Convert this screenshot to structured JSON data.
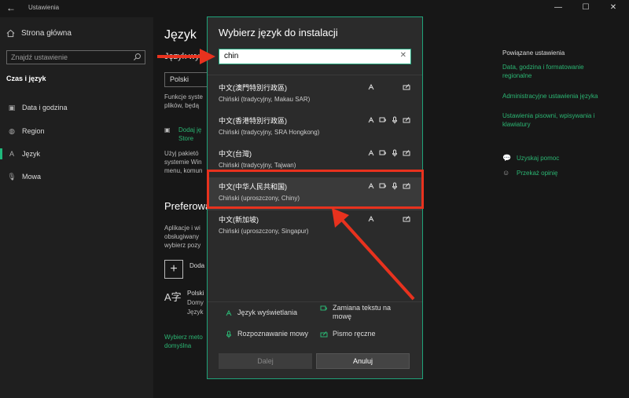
{
  "window": {
    "title": "Ustawienia",
    "back_glyph": "←",
    "controls": {
      "minimize": "—",
      "maximize": "☐",
      "close": "✕"
    }
  },
  "sidebar": {
    "home": {
      "icon": "home-icon",
      "label": "Strona główna"
    },
    "search": {
      "placeholder": "Znajdź ustawienie",
      "icon": "search-icon"
    },
    "section": "Czas i język",
    "items": [
      {
        "icon": "calendar-clock-icon",
        "label": "Data i godzina",
        "active": false
      },
      {
        "icon": "globe-icon",
        "label": "Region",
        "active": false
      },
      {
        "icon": "language-icon",
        "label": "Język",
        "active": true
      },
      {
        "icon": "microphone-icon",
        "label": "Mowa",
        "active": false
      }
    ]
  },
  "main": {
    "title": "Język",
    "subtitle": "Język wyśw",
    "select_value": "Polski",
    "text1": [
      "Funkcje syste",
      "plików, będą"
    ],
    "store_link": [
      "Dodaj ję",
      "Store"
    ],
    "text2": [
      "Użyj pakietó",
      "systemie Win",
      "menu, komun"
    ],
    "preferred_heading": "Preferowa",
    "text3": [
      "Aplikacje i wi",
      "obsługiwany",
      "wybierz pozy"
    ],
    "add_label": "Doda",
    "lang_entry": [
      "Polski",
      "Domy",
      "Język"
    ],
    "lang_icon_glyph": "A字",
    "bottom_link": [
      "Wybierz meto",
      "domyślna"
    ]
  },
  "right_panel": {
    "heading": "Powiązane ustawienia",
    "links": [
      [
        "Data, godzina i formatowanie",
        "regionalne"
      ],
      [
        "Administracyjne ustawienia języka"
      ],
      [
        "Ustawienia pisowni, wpisywania i",
        "klawiatury"
      ]
    ],
    "help": [
      {
        "icon": "help-chat-icon",
        "label": "Uzyskaj pomoc"
      },
      {
        "icon": "feedback-icon",
        "label": "Przekaż opinię"
      }
    ]
  },
  "dialog": {
    "title": "Wybierz język do instalacji",
    "search_value": "chin",
    "clear_glyph": "✕",
    "languages": [
      {
        "native": "中文(澳門特別行政區)",
        "name": "Chiński (tradycyjny, Makau SAR)",
        "features": [
          "display",
          "handwriting"
        ],
        "selected": false
      },
      {
        "native": "中文(香港特別行政區)",
        "name": "Chiński (tradycyjny, SRA Hongkong)",
        "features": [
          "display",
          "tts",
          "speech",
          "handwriting"
        ],
        "selected": false
      },
      {
        "native": "中文(台灣)",
        "name": "Chiński (tradycyjny, Tajwan)",
        "features": [
          "display",
          "tts",
          "speech",
          "handwriting"
        ],
        "selected": false
      },
      {
        "native": "中文(中华人民共和国)",
        "name": "Chiński (uproszczony, Chiny)",
        "features": [
          "display",
          "tts",
          "speech",
          "handwriting"
        ],
        "selected": true
      },
      {
        "native": "中文(新加坡)",
        "name": "Chiński (uproszczony, Singapur)",
        "features": [
          "display",
          "handwriting"
        ],
        "selected": false
      }
    ],
    "legend": {
      "display": "Język wyświetlania",
      "tts": [
        "Zamiana tekstu na",
        "mowę"
      ],
      "speech": "Rozpoznawanie mowy",
      "handwriting": "Pismo ręczne"
    },
    "buttons": {
      "next": "Dalej",
      "cancel": "Anuluj"
    }
  },
  "colors": {
    "accent": "#1fb87b",
    "link": "#2bb673",
    "annotation": "#e8321e",
    "dialog_border": "#1fa37a"
  }
}
